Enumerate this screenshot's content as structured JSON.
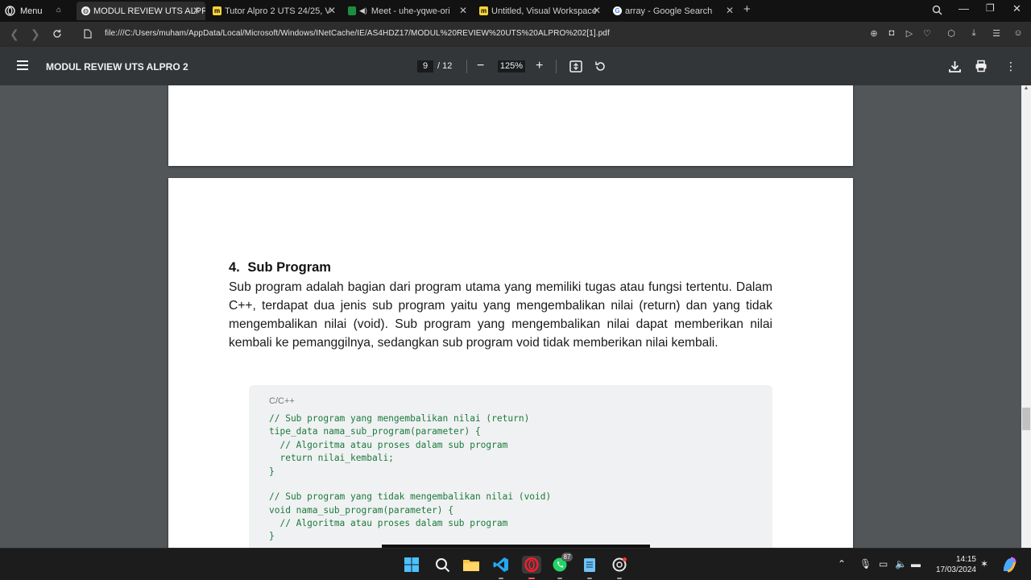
{
  "browser": {
    "menu_label": "Menu",
    "tabs": [
      {
        "title": "MODUL REVIEW UTS ALPR",
        "active": true,
        "favicon": "globe-icon"
      },
      {
        "title": "Tutor Alpro 2 UTS 24/25, V",
        "active": false,
        "favicon": "miro-icon"
      },
      {
        "title": "Meet - uhe-yqwe-ori",
        "active": false,
        "favicon": "meet-icon"
      },
      {
        "title": "Untitled, Visual Workspace",
        "active": false,
        "favicon": "miro-icon"
      },
      {
        "title": "array - Google Search",
        "active": false,
        "favicon": "google-icon"
      }
    ],
    "new_tab": "+",
    "address": "file:///C:/Users/muham/AppData/Local/Microsoft/Windows/INetCache/IE/AS4HDZ17/MODUL%20REVIEW%20UTS%20ALPRO%202[1].pdf"
  },
  "pdf": {
    "doc_title": "MODUL REVIEW UTS ALPRO 2",
    "current_page": "9",
    "total_pages": "/ 12",
    "zoom": "125%",
    "section_number": "4.",
    "section_title": "Sub Program",
    "paragraph": "Sub program adalah bagian dari program utama yang memiliki tugas atau fungsi tertentu. Dalam C++, terdapat dua jenis sub program yaitu yang mengembalikan nilai (return) dan yang tidak mengembalikan nilai (void). Sub program yang mengembalikan nilai dapat memberikan nilai kembali ke pemanggilnya, sedangkan sub program void tidak memberikan nilai kembali.",
    "code_language": "C/C++",
    "code_lines": [
      "// Sub program yang mengembalikan nilai (return)",
      "tipe_data nama_sub_program(parameter) {",
      "  // Algoritma atau proses dalam sub program",
      "  return nilai_kembali;",
      "}",
      "",
      "// Sub program yang tidak mengembalikan nilai (void)",
      "void nama_sub_program(parameter) {",
      "  // Algoritma atau proses dalam sub program",
      "}"
    ]
  },
  "taskbar": {
    "whatsapp_badge": "87",
    "time": "14:15",
    "date": "17/03/2024"
  },
  "colors": {
    "accent_opera": "#ff1b2d",
    "code_green": "#1b7a3a",
    "viewer_bg": "#525659",
    "toolbar_bg": "#323639"
  }
}
